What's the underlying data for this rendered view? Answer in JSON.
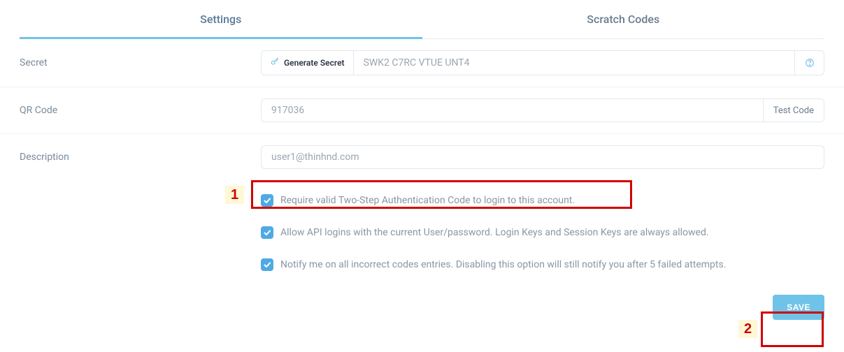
{
  "tabs": {
    "settings": "Settings",
    "scratch_codes": "Scratch Codes"
  },
  "fields": {
    "secret": {
      "label": "Secret",
      "generate_btn": "Generate Secret",
      "value": "SWK2 C7RC VTUE UNT4"
    },
    "qr_code": {
      "label": "QR Code",
      "value": "917036",
      "test_btn": "Test Code"
    },
    "description": {
      "label": "Description",
      "value": "user1@thinhnd.com"
    }
  },
  "checkboxes": {
    "require_2fa": {
      "checked": true,
      "label": "Require valid Two-Step Authentication Code to login to this account."
    },
    "allow_api": {
      "checked": true,
      "label": "Allow API logins with the current User/password. Login Keys and Session Keys are always allowed."
    },
    "notify_incorrect": {
      "checked": true,
      "label": "Notify me on all incorrect codes entries. Disabling this option will still notify you after 5 failed attempts."
    }
  },
  "actions": {
    "save": "SAVE"
  },
  "annotations": {
    "one": "1",
    "two": "2"
  }
}
